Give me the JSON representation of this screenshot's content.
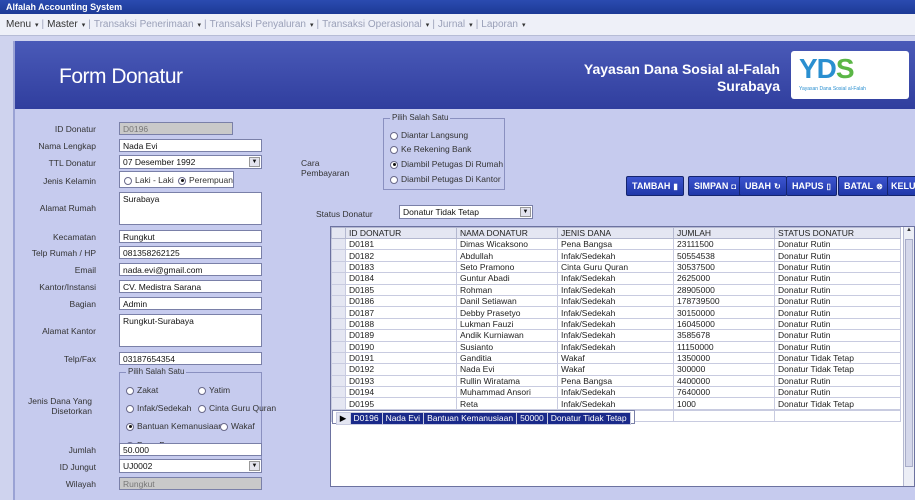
{
  "app_title": "Alfalah Accounting System",
  "menu": [
    {
      "label": "Menu",
      "dim": false
    },
    {
      "label": "Master",
      "dim": false
    },
    {
      "label": "Transaksi Penerimaan",
      "dim": true
    },
    {
      "label": "Transaksi Penyaluran",
      "dim": true
    },
    {
      "label": "Transaksi Operasional",
      "dim": true
    },
    {
      "label": "Jurnal",
      "dim": true
    },
    {
      "label": "Laporan",
      "dim": true
    }
  ],
  "header": {
    "form_title": "Form Donatur",
    "org_line1": "Yayasan Dana Sosial al-Falah",
    "org_line2": "Surabaya",
    "logo_text": "YDS",
    "logo_sub": "Yayasan Dana Sosial al-Falah"
  },
  "fields": {
    "id_donatur": {
      "label": "ID Donatur",
      "value": "D0196"
    },
    "nama_lengkap": {
      "label": "Nama Lengkap",
      "value": "Nada Evi"
    },
    "ttl_donatur": {
      "label": "TTL Donatur",
      "value": "07 Desember 1992"
    },
    "jenis_kelamin": {
      "label": "Jenis Kelamin",
      "options": [
        "Laki - Laki",
        "Perempuan"
      ],
      "selected": "Perempuan"
    },
    "alamat_rumah": {
      "label": "Alamat Rumah",
      "value": "Surabaya"
    },
    "kecamatan": {
      "label": "Kecamatan",
      "value": "Rungkut"
    },
    "telp_rumah": {
      "label": "Telp Rumah / HP",
      "value": "081358262125"
    },
    "email": {
      "label": "Email",
      "value": "nada.evi@gmail.com"
    },
    "kantor": {
      "label": "Kantor/Instansi",
      "value": "CV. Medistra Sarana"
    },
    "bagian": {
      "label": "Bagian",
      "value": "Admin"
    },
    "alamat_kantor": {
      "label": "Alamat Kantor",
      "value": "Rungkut-Surabaya"
    },
    "telp_fax": {
      "label": "Telp/Fax",
      "value": "03187654354"
    },
    "jenis_dana": {
      "label": "Jenis Dana Yang Disetorkan",
      "group_label": "Pilih Salah Satu",
      "options": [
        "Zakat",
        "Yatim",
        "Infak/Sedekah",
        "Cinta Guru Quran",
        "Bantuan Kemanusiaan",
        "Wakaf",
        "Pena Bangsa"
      ],
      "selected": "Bantuan Kemanusiaan"
    },
    "jumlah": {
      "label": "Jumlah",
      "value": "50.000"
    },
    "id_jungut": {
      "label": "ID Jungut",
      "value": "UJ0002"
    },
    "wilayah": {
      "label": "Wilayah",
      "value": "Rungkut"
    }
  },
  "payment": {
    "label": "Cara Pembayaran",
    "group_label": "Pilih Salah Satu",
    "options": [
      "Diantar Langsung",
      "Ke Rekening Bank",
      "Diambil Petugas Di Rumah",
      "Diambil Petugas Di Kantor"
    ],
    "selected": "Diambil Petugas Di Rumah"
  },
  "status": {
    "label": "Status Donatur",
    "value": "Donatur Tidak Tetap"
  },
  "buttons": {
    "tambah": "TAMBAH",
    "simpan": "SIMPAN",
    "ubah": "UBAH",
    "hapus": "HAPUS",
    "batal": "BATAL",
    "keluar": "KELUAR"
  },
  "grid": {
    "columns": [
      "ID DONATUR",
      "NAMA DONATUR",
      "JENIS DANA",
      "JUMLAH",
      "STATUS DONATUR"
    ],
    "rows": [
      [
        "D0181",
        "Dimas Wicaksono",
        "Pena Bangsa",
        "23111500",
        "Donatur Rutin"
      ],
      [
        "D0182",
        "Abdullah",
        "Infak/Sedekah",
        "50554538",
        "Donatur Rutin"
      ],
      [
        "D0183",
        "Seto Pramono",
        "Cinta Guru Quran",
        "30537500",
        "Donatur Rutin"
      ],
      [
        "D0184",
        "Guntur Abadi",
        "Infak/Sedekah",
        "2625000",
        "Donatur Rutin"
      ],
      [
        "D0185",
        "Rohman",
        "Infak/Sedekah",
        "28905000",
        "Donatur Rutin"
      ],
      [
        "D0186",
        "Danil Setiawan",
        "Infak/Sedekah",
        "178739500",
        "Donatur Rutin"
      ],
      [
        "D0187",
        "Debby Prasetyo",
        "Infak/Sedekah",
        "30150000",
        "Donatur Rutin"
      ],
      [
        "D0188",
        "Lukman Fauzi",
        "Infak/Sedekah",
        "16045000",
        "Donatur Rutin"
      ],
      [
        "D0189",
        "Andik Kurniawan",
        "Infak/Sedekah",
        "3585678",
        "Donatur Rutin"
      ],
      [
        "D0190",
        "Susianto",
        "Infak/Sedekah",
        "11150000",
        "Donatur Rutin"
      ],
      [
        "D0191",
        "Ganditia",
        "Wakaf",
        "1350000",
        "Donatur Tidak Tetap"
      ],
      [
        "D0192",
        "Nada Evi",
        "Wakaf",
        "300000",
        "Donatur Tidak Tetap"
      ],
      [
        "D0193",
        "Rullin Wiratama",
        "Pena Bangsa",
        "4400000",
        "Donatur Rutin"
      ],
      [
        "D0194",
        "Muhammad Ansori",
        "Infak/Sedekah",
        "7640000",
        "Donatur Rutin"
      ],
      [
        "D0195",
        "Reta",
        "Infak/Sedekah",
        "1000",
        "Donatur Tidak Tetap"
      ],
      [
        "D0196",
        "Nada Evi",
        "Bantuan Kemanusiaan",
        "50000",
        "Donatur Tidak Tetap"
      ]
    ],
    "selected_row": "D0196"
  }
}
